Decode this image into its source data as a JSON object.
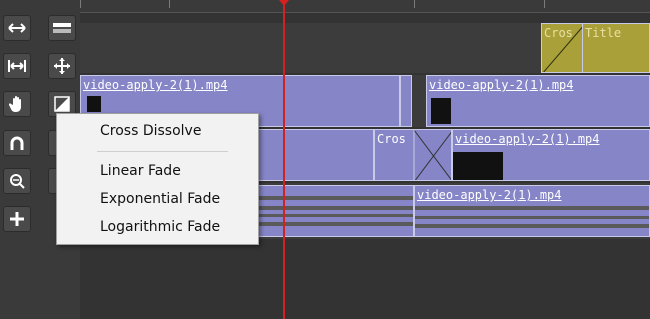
{
  "toolbar": {
    "buttons": [
      {
        "name": "move-horizontal-icon"
      },
      {
        "name": "ripple-icon"
      },
      {
        "name": "fit-width-icon"
      },
      {
        "name": "move-cross-icon"
      },
      {
        "name": "hand-tool-icon"
      },
      {
        "name": "transition-icon"
      },
      {
        "name": "snap-magnet-icon"
      },
      {
        "name": "zoom-fit-icon"
      },
      {
        "name": "add-track-icon"
      }
    ]
  },
  "timeline": {
    "clips": {
      "v1_left": "video-apply-2(1).mp4",
      "v1_right": "video-apply-2(1).mp4",
      "v2_right": "video-apply-2(1).mp4",
      "a1_right": "video-apply-2(1).mp4"
    },
    "transitions": {
      "top_cross": "Cros",
      "top_title": "Title",
      "mid_cross": "Cros"
    }
  },
  "context_menu": {
    "items": [
      "Cross Dissolve",
      "Linear Fade",
      "Exponential Fade",
      "Logarithmic Fade"
    ]
  },
  "colors": {
    "clip": "#8585c7",
    "transition": "#a9a03a",
    "playhead": "#d42020"
  }
}
